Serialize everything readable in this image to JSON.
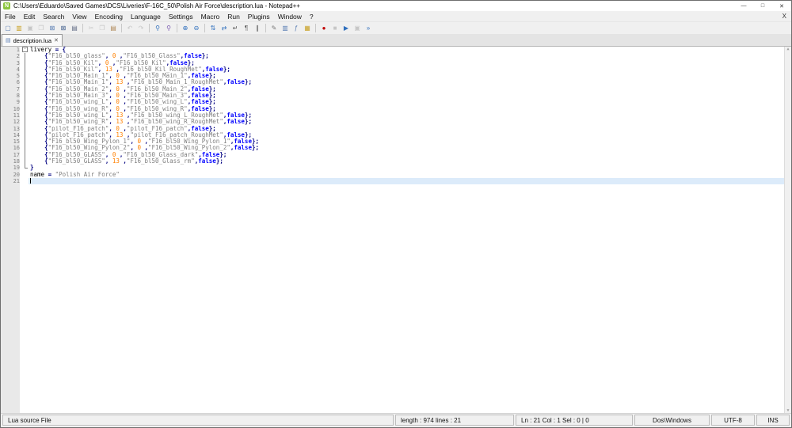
{
  "window": {
    "title": "C:\\Users\\Eduardo\\Saved Games\\DCS\\Liveries\\F-16C_50\\Polish Air Force\\description.lua - Notepad++",
    "icon_glyph": "N",
    "controls": {
      "minimize": "—",
      "maximize": "□",
      "close": "✕"
    }
  },
  "menu": {
    "items": [
      {
        "id": "file",
        "label": "File"
      },
      {
        "id": "edit",
        "label": "Edit"
      },
      {
        "id": "search",
        "label": "Search"
      },
      {
        "id": "view",
        "label": "View"
      },
      {
        "id": "encoding",
        "label": "Encoding"
      },
      {
        "id": "language",
        "label": "Language"
      },
      {
        "id": "settings",
        "label": "Settings"
      },
      {
        "id": "macro",
        "label": "Macro"
      },
      {
        "id": "run",
        "label": "Run"
      },
      {
        "id": "plugins",
        "label": "Plugins"
      },
      {
        "id": "window",
        "label": "Window"
      },
      {
        "id": "help",
        "label": "?"
      }
    ],
    "close_glyph": "X"
  },
  "toolbar": {
    "icons": [
      {
        "name": "new-file-icon",
        "glyph": "▢",
        "color": "#5b7fb4"
      },
      {
        "name": "open-file-icon",
        "glyph": "▥",
        "color": "#c9a227"
      },
      {
        "name": "save-icon",
        "glyph": "▣",
        "color": "#9aa0a6",
        "disabled": true
      },
      {
        "name": "save-all-icon",
        "glyph": "❐",
        "color": "#9aa0a6",
        "disabled": true
      },
      {
        "name": "close-document-icon",
        "glyph": "⊠",
        "color": "#5b7fb4"
      },
      {
        "name": "close-all-documents-icon",
        "glyph": "⊠",
        "color": "#44618e"
      },
      {
        "name": "print-icon",
        "glyph": "▤",
        "color": "#667088"
      },
      {
        "separator": true
      },
      {
        "name": "cut-icon",
        "glyph": "✂",
        "color": "#9aa0a6",
        "disabled": true
      },
      {
        "name": "copy-icon",
        "glyph": "❐",
        "color": "#9aa0a6",
        "disabled": true
      },
      {
        "name": "paste-icon",
        "glyph": "▤",
        "color": "#b08a5a"
      },
      {
        "separator": true
      },
      {
        "name": "undo-icon",
        "glyph": "↶",
        "color": "#9aa0a6",
        "disabled": true
      },
      {
        "name": "redo-icon",
        "glyph": "↷",
        "color": "#9aa0a6",
        "disabled": true
      },
      {
        "separator": true
      },
      {
        "name": "find-icon",
        "glyph": "⚲",
        "color": "#2f6fbd"
      },
      {
        "name": "replace-icon",
        "glyph": "⚲",
        "color": "#7a5ab0"
      },
      {
        "separator": true
      },
      {
        "name": "zoom-in-icon",
        "glyph": "⊕",
        "color": "#2f6fbd"
      },
      {
        "name": "zoom-out-icon",
        "glyph": "⊖",
        "color": "#2f6fbd"
      },
      {
        "separator": true
      },
      {
        "name": "sync-vertical-icon",
        "glyph": "⇅",
        "color": "#2f6fbd"
      },
      {
        "name": "sync-horizontal-icon",
        "glyph": "⇄",
        "color": "#2f6fbd"
      },
      {
        "name": "word-wrap-icon",
        "glyph": "↵",
        "color": "#555555"
      },
      {
        "name": "show-all-characters-icon",
        "glyph": "¶",
        "color": "#555555"
      },
      {
        "name": "indent-guide-icon",
        "glyph": "∥",
        "color": "#555555"
      },
      {
        "separator": true
      },
      {
        "name": "user-defined-language-icon",
        "glyph": "✎",
        "color": "#777777"
      },
      {
        "name": "document-map-icon",
        "glyph": "▥",
        "color": "#5b7fb4"
      },
      {
        "name": "function-list-icon",
        "glyph": "ƒ",
        "color": "#5b7fb4"
      },
      {
        "name": "folder-workspace-icon",
        "glyph": "▦",
        "color": "#c9a227"
      },
      {
        "separator": true
      },
      {
        "name": "record-macro-icon",
        "glyph": "●",
        "color": "#c00000"
      },
      {
        "name": "stop-recording-icon",
        "glyph": "■",
        "color": "#9aa0a6",
        "disabled": true
      },
      {
        "name": "playback-macro-icon",
        "glyph": "▶",
        "color": "#2f6fbd"
      },
      {
        "name": "save-macro-icon",
        "glyph": "▣",
        "color": "#9aa0a6",
        "disabled": true
      },
      {
        "name": "run-macro-multiple-icon",
        "glyph": "»",
        "color": "#2f6fbd"
      }
    ]
  },
  "tabs": [
    {
      "label": "description.lua",
      "icon": "▤",
      "close": "✕",
      "active": true
    }
  ],
  "editor": {
    "caret_line": 21,
    "fold_collapse_glyph": "-",
    "lines": [
      {
        "fold": "open",
        "tokens": [
          [
            "n",
            "livery "
          ],
          [
            "o",
            "="
          ],
          [
            "n",
            " "
          ],
          [
            "o",
            "{"
          ]
        ]
      },
      {
        "fold": "line",
        "tokens": [
          [
            "n",
            "    "
          ],
          [
            "o",
            "{"
          ],
          [
            "s",
            "\"F16_bl50_glass\""
          ],
          [
            "o",
            ","
          ],
          [
            "n",
            " "
          ],
          [
            "d",
            "0"
          ],
          [
            "n",
            " "
          ],
          [
            "o",
            ","
          ],
          [
            "s",
            "\"F16_bl50_Glass\""
          ],
          [
            "o",
            ","
          ],
          [
            "k",
            "false"
          ],
          [
            "o",
            "};"
          ]
        ]
      },
      {
        "fold": "line",
        "tokens": [
          [
            "n",
            "    "
          ],
          [
            "o",
            "{"
          ],
          [
            "s",
            "\"F16_bl50_Kil\""
          ],
          [
            "o",
            ","
          ],
          [
            "n",
            " "
          ],
          [
            "d",
            "0"
          ],
          [
            "n",
            " "
          ],
          [
            "o",
            ","
          ],
          [
            "s",
            "\"F16_bl50_Kil\""
          ],
          [
            "o",
            ","
          ],
          [
            "k",
            "false"
          ],
          [
            "o",
            "};"
          ]
        ]
      },
      {
        "fold": "line",
        "tokens": [
          [
            "n",
            "    "
          ],
          [
            "o",
            "{"
          ],
          [
            "s",
            "\"F16_bl50_Kil\""
          ],
          [
            "o",
            ","
          ],
          [
            "n",
            " "
          ],
          [
            "d",
            "13"
          ],
          [
            "n",
            " "
          ],
          [
            "o",
            ","
          ],
          [
            "s",
            "\"F16_bl50_Kil_RoughMet\""
          ],
          [
            "o",
            ","
          ],
          [
            "k",
            "false"
          ],
          [
            "o",
            "};"
          ]
        ]
      },
      {
        "fold": "line",
        "tokens": [
          [
            "n",
            "    "
          ],
          [
            "o",
            "{"
          ],
          [
            "s",
            "\"F16_bl50_Main_1\""
          ],
          [
            "o",
            ","
          ],
          [
            "n",
            " "
          ],
          [
            "d",
            "0"
          ],
          [
            "n",
            " "
          ],
          [
            "o",
            ","
          ],
          [
            "s",
            "\"F16_bl50_Main_1\""
          ],
          [
            "o",
            ","
          ],
          [
            "k",
            "false"
          ],
          [
            "o",
            "};"
          ]
        ]
      },
      {
        "fold": "line",
        "tokens": [
          [
            "n",
            "    "
          ],
          [
            "o",
            "{"
          ],
          [
            "s",
            "\"F16_bl50_Main_1\""
          ],
          [
            "o",
            ","
          ],
          [
            "n",
            " "
          ],
          [
            "d",
            "13"
          ],
          [
            "n",
            " "
          ],
          [
            "o",
            ","
          ],
          [
            "s",
            "\"F16_bl50_Main_1_RoughMet\""
          ],
          [
            "o",
            ","
          ],
          [
            "k",
            "false"
          ],
          [
            "o",
            "};"
          ]
        ]
      },
      {
        "fold": "line",
        "tokens": [
          [
            "n",
            "    "
          ],
          [
            "o",
            "{"
          ],
          [
            "s",
            "\"F16_bl50_Main_2\""
          ],
          [
            "o",
            ","
          ],
          [
            "n",
            " "
          ],
          [
            "d",
            "0"
          ],
          [
            "n",
            " "
          ],
          [
            "o",
            ","
          ],
          [
            "s",
            "\"F16_bl50_Main_2\""
          ],
          [
            "o",
            ","
          ],
          [
            "k",
            "false"
          ],
          [
            "o",
            "};"
          ]
        ]
      },
      {
        "fold": "line",
        "tokens": [
          [
            "n",
            "    "
          ],
          [
            "o",
            "{"
          ],
          [
            "s",
            "\"F16_bl50_Main_3\""
          ],
          [
            "o",
            ","
          ],
          [
            "n",
            " "
          ],
          [
            "d",
            "0"
          ],
          [
            "n",
            " "
          ],
          [
            "o",
            ","
          ],
          [
            "s",
            "\"F16_bl50_Main_3\""
          ],
          [
            "o",
            ","
          ],
          [
            "k",
            "false"
          ],
          [
            "o",
            "};"
          ]
        ]
      },
      {
        "fold": "line",
        "tokens": [
          [
            "n",
            "    "
          ],
          [
            "o",
            "{"
          ],
          [
            "s",
            "\"F16_bl50_wing_L\""
          ],
          [
            "o",
            ","
          ],
          [
            "n",
            " "
          ],
          [
            "d",
            "0"
          ],
          [
            "n",
            " "
          ],
          [
            "o",
            ","
          ],
          [
            "s",
            "\"F16_bl50_wing_L\""
          ],
          [
            "o",
            ","
          ],
          [
            "k",
            "false"
          ],
          [
            "o",
            "};"
          ]
        ]
      },
      {
        "fold": "line",
        "tokens": [
          [
            "n",
            "    "
          ],
          [
            "o",
            "{"
          ],
          [
            "s",
            "\"F16_bl50_wing_R\""
          ],
          [
            "o",
            ","
          ],
          [
            "n",
            " "
          ],
          [
            "d",
            "0"
          ],
          [
            "n",
            " "
          ],
          [
            "o",
            ","
          ],
          [
            "s",
            "\"F16_bl50_wing_R\""
          ],
          [
            "o",
            ","
          ],
          [
            "k",
            "false"
          ],
          [
            "o",
            "};"
          ]
        ]
      },
      {
        "fold": "line",
        "tokens": [
          [
            "n",
            "    "
          ],
          [
            "o",
            "{"
          ],
          [
            "s",
            "\"F16_bl50_wing_L\""
          ],
          [
            "o",
            ","
          ],
          [
            "n",
            " "
          ],
          [
            "d",
            "13"
          ],
          [
            "n",
            " "
          ],
          [
            "o",
            ","
          ],
          [
            "s",
            "\"F16_bl50_wing_L_RoughMet\""
          ],
          [
            "o",
            ","
          ],
          [
            "k",
            "false"
          ],
          [
            "o",
            "};"
          ]
        ]
      },
      {
        "fold": "line",
        "tokens": [
          [
            "n",
            "    "
          ],
          [
            "o",
            "{"
          ],
          [
            "s",
            "\"F16_bl50_wing_R\""
          ],
          [
            "o",
            ","
          ],
          [
            "n",
            " "
          ],
          [
            "d",
            "13"
          ],
          [
            "n",
            " "
          ],
          [
            "o",
            ","
          ],
          [
            "s",
            "\"F16_bl50_wing_R_RoughMet\""
          ],
          [
            "o",
            ","
          ],
          [
            "k",
            "false"
          ],
          [
            "o",
            "};"
          ]
        ]
      },
      {
        "fold": "line",
        "tokens": [
          [
            "n",
            "    "
          ],
          [
            "o",
            "{"
          ],
          [
            "s",
            "\"pilot_F16_patch\""
          ],
          [
            "o",
            ","
          ],
          [
            "n",
            " "
          ],
          [
            "d",
            "0"
          ],
          [
            "n",
            " "
          ],
          [
            "o",
            ","
          ],
          [
            "s",
            "\"pilot_F16_patch\""
          ],
          [
            "o",
            ","
          ],
          [
            "k",
            "false"
          ],
          [
            "o",
            "};"
          ]
        ]
      },
      {
        "fold": "line",
        "tokens": [
          [
            "n",
            "    "
          ],
          [
            "o",
            "{"
          ],
          [
            "s",
            "\"pilot_F16_patch\""
          ],
          [
            "o",
            ","
          ],
          [
            "n",
            " "
          ],
          [
            "d",
            "13"
          ],
          [
            "n",
            " "
          ],
          [
            "o",
            ","
          ],
          [
            "s",
            "\"pilot_F16_patch_RoughMet\""
          ],
          [
            "o",
            ","
          ],
          [
            "k",
            "false"
          ],
          [
            "o",
            "};"
          ]
        ]
      },
      {
        "fold": "line",
        "tokens": [
          [
            "n",
            "    "
          ],
          [
            "o",
            "{"
          ],
          [
            "s",
            "\"F16_bl50_Wing_Pylon_1\""
          ],
          [
            "o",
            ","
          ],
          [
            "n",
            " "
          ],
          [
            "d",
            "0"
          ],
          [
            "n",
            " "
          ],
          [
            "o",
            ","
          ],
          [
            "s",
            "\"F16_bl50_Wing_Pylon_1\""
          ],
          [
            "o",
            ","
          ],
          [
            "k",
            "false"
          ],
          [
            "o",
            "};"
          ]
        ]
      },
      {
        "fold": "line",
        "tokens": [
          [
            "n",
            "    "
          ],
          [
            "o",
            "{"
          ],
          [
            "s",
            "\"F16_bl50_Wing_Pylon_2\""
          ],
          [
            "o",
            ","
          ],
          [
            "n",
            " "
          ],
          [
            "d",
            "0"
          ],
          [
            "n",
            " "
          ],
          [
            "o",
            ","
          ],
          [
            "s",
            "\"F16_bl50_Wing_Pylon_2\""
          ],
          [
            "o",
            ","
          ],
          [
            "k",
            "false"
          ],
          [
            "o",
            "};"
          ]
        ]
      },
      {
        "fold": "line",
        "tokens": [
          [
            "n",
            "    "
          ],
          [
            "o",
            "{"
          ],
          [
            "s",
            "\"F16_bl50_GLASS\""
          ],
          [
            "o",
            ","
          ],
          [
            "n",
            " "
          ],
          [
            "d",
            "0"
          ],
          [
            "n",
            " "
          ],
          [
            "o",
            ","
          ],
          [
            "s",
            "\"F16_bl50_Glass_dark\""
          ],
          [
            "o",
            ","
          ],
          [
            "k",
            "false"
          ],
          [
            "o",
            "};"
          ]
        ]
      },
      {
        "fold": "line",
        "tokens": [
          [
            "n",
            "    "
          ],
          [
            "o",
            "{"
          ],
          [
            "s",
            "\"F16_bl50_GLASS\""
          ],
          [
            "o",
            ","
          ],
          [
            "n",
            " "
          ],
          [
            "d",
            "13"
          ],
          [
            "n",
            " "
          ],
          [
            "o",
            ","
          ],
          [
            "s",
            "\"F16_bl50_Glass_rm\""
          ],
          [
            "o",
            ","
          ],
          [
            "k",
            "false"
          ],
          [
            "o",
            "};"
          ]
        ]
      },
      {
        "fold": "end",
        "tokens": [
          [
            "o",
            "}"
          ]
        ]
      },
      {
        "fold": "none",
        "tokens": [
          [
            "n",
            "name "
          ],
          [
            "o",
            "="
          ],
          [
            "n",
            " "
          ],
          [
            "s",
            "\"Polish Air Force\""
          ]
        ]
      },
      {
        "fold": "none",
        "tokens": []
      }
    ]
  },
  "scrollbar": {
    "up": "▲",
    "down": "▼"
  },
  "status": {
    "doctype": "Lua source File",
    "length_lines": "length : 974   lines : 21",
    "position": "Ln : 21   Col : 1   Sel : 0 | 0",
    "eol": "Dos\\Windows",
    "encoding": "UTF-8",
    "insert_mode": "INS"
  }
}
